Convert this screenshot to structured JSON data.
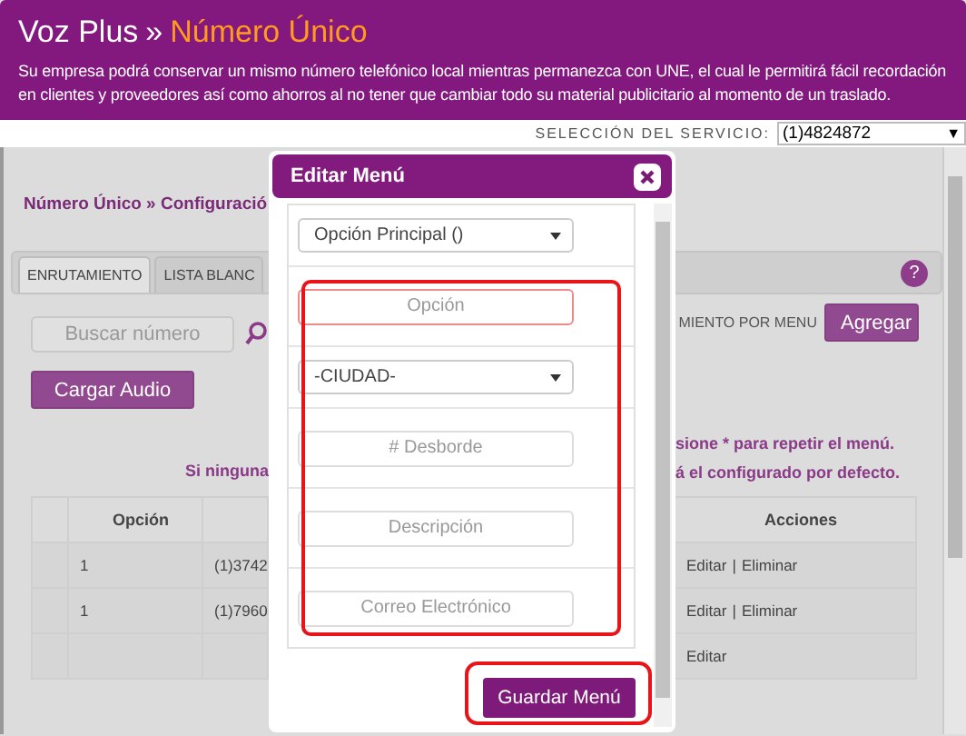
{
  "header": {
    "brand": "Voz Plus",
    "separator": "»",
    "title": "Número Único",
    "description": "Su empresa podrá conservar un mismo número telefónico local mientras permanezca con UNE, el cual le permitirá fácil recordación en clientes y proveedores así como ahorros al no tener que cambiar todo su material publicitario al momento de un traslado."
  },
  "service": {
    "label": "SELECCIÓN DEL SERVICIO:",
    "value": "(1)4824872",
    "arrow": "▼"
  },
  "breadcrumb": "Número Único » Configuració",
  "tabs": [
    {
      "label": "ENRUTAMIENTO",
      "selected": true
    },
    {
      "label": "LISTA BLANC",
      "selected": false
    }
  ],
  "help": "?",
  "search": {
    "placeholder": "Buscar número"
  },
  "routing_label": "MIENTO POR MENU",
  "add_button": "Agregar",
  "upload_button": "Cargar Audio",
  "notes": {
    "left": "Si ninguna",
    "right": [
      "sione * para repetir el menú.",
      "á el configurado por defecto."
    ]
  },
  "table": {
    "columns": [
      "",
      "Opción",
      "",
      "",
      "Acciones"
    ],
    "rows": [
      {
        "option": "1",
        "column_3": "(1)3742",
        "actions": [
          "Editar",
          "Eliminar"
        ]
      },
      {
        "option": "1",
        "column_3": "(1)7960",
        "actions": [
          "Editar",
          "Eliminar"
        ]
      },
      {
        "option": "",
        "column_3": "",
        "actions": [
          "Editar"
        ]
      }
    ],
    "action_separator": "|"
  },
  "dialog": {
    "title": "Editar Menú",
    "fields": [
      {
        "kind": "select",
        "value": "Opción Principal ()"
      },
      {
        "kind": "input",
        "placeholder": "Opción",
        "focused": true
      },
      {
        "kind": "select",
        "value": "-CIUDAD-"
      },
      {
        "kind": "input",
        "placeholder": "# Desborde",
        "focused": false
      },
      {
        "kind": "input",
        "placeholder": "Descripción",
        "focused": false
      },
      {
        "kind": "input",
        "placeholder": "Correo Electrónico",
        "focused": false
      }
    ],
    "save_button": "Guardar Menú"
  }
}
